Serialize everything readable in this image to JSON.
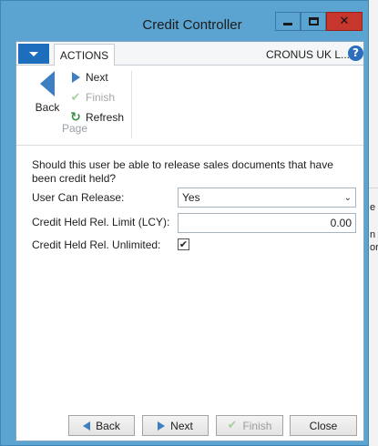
{
  "window": {
    "title": "Credit Controller",
    "close_glyph": "✕"
  },
  "ribbon": {
    "active_tab": "ACTIONS",
    "company": "CRONUS UK L...",
    "help_glyph": "?",
    "back_label": "Back",
    "next_label": "Next",
    "finish_label": "Finish",
    "refresh_label": "Refresh",
    "group_label": "Page",
    "icons": {
      "back": "back-arrow-icon",
      "next": "next-arrow-icon",
      "finish": "checkmark-icon",
      "refresh": "refresh-icon"
    }
  },
  "form": {
    "question": "Should this user be able to release sales documents that have been credit held?",
    "fields": [
      {
        "label": "User Can Release:",
        "value": "Yes",
        "type": "select"
      },
      {
        "label": "Credit Held Rel. Limit (LCY):",
        "value": "0.00",
        "type": "number"
      },
      {
        "label": "Credit Held Rel. Unlimited:",
        "value": "✔",
        "type": "checkbox",
        "checked": true
      }
    ]
  },
  "footer": {
    "back": "Back",
    "next": "Next",
    "finish": "Finish",
    "close": "Close"
  },
  "background_app": {
    "snippets": [
      "e",
      "n",
      "or"
    ]
  },
  "colors": {
    "window_frame": "#5ba3d0",
    "close_button": "#c7362c",
    "accent_blue": "#3d7fc1",
    "menu_button": "#1d6fbe",
    "refresh_green": "#3a8f43"
  }
}
